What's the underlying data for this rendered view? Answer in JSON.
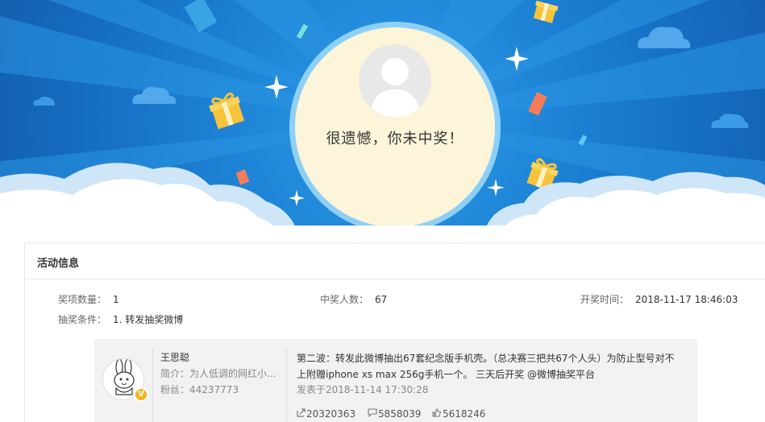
{
  "result": {
    "message": "很遗憾，你未中奖！"
  },
  "activity": {
    "title": "活动信息",
    "prize_count": {
      "label": "奖项数量：",
      "value": "1"
    },
    "winner_count": {
      "label": "中奖人数：",
      "value": "67"
    },
    "draw_time": {
      "label": "开奖时间：",
      "value": "2018-11-17 18:46:03"
    },
    "condition": {
      "label": "抽奖条件：",
      "value": "1. 转发抽奖微博"
    }
  },
  "weibo_card": {
    "user_name": "王思聪",
    "bio": "简介：为人低调的网红小...",
    "fans": "粉丝：44237773",
    "post_text": "第二波：转发此微博抽出67套纪念版手机壳。（总决赛三把共67个人头）为防止型号对不上附赠iphone xs max 256g手机一个。 三天后开奖 @微博抽奖平台",
    "post_date": "发表于2018-11-14 17:30:28",
    "reposts": "20320363",
    "comments": "5858039",
    "likes": "5618246"
  },
  "icons": {
    "repost": "repost-icon",
    "comment": "comment-icon",
    "like": "thumb-up-icon",
    "verified": "verified-v-badge-icon"
  },
  "colors": {
    "banner_blue": "#1f86d8",
    "circle_cream": "#fdf5da",
    "card_bg": "#f2f2f2",
    "badge_gold": "#f3b51b"
  }
}
